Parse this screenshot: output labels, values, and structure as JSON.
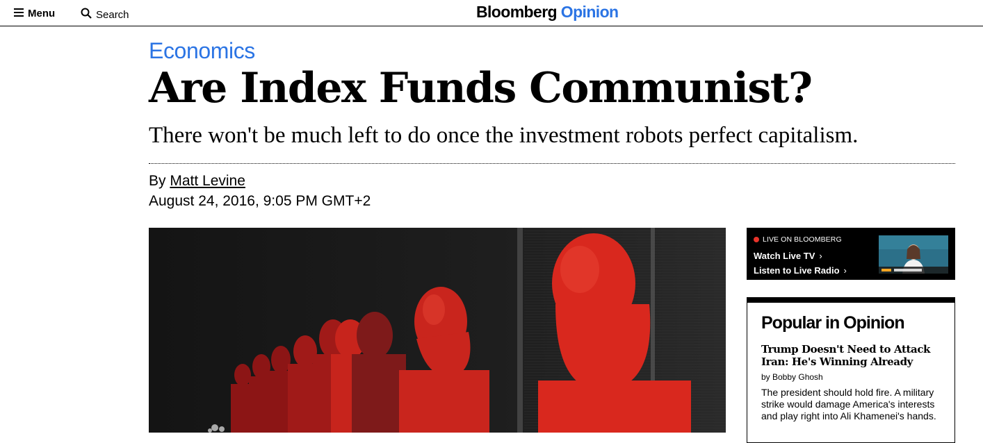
{
  "header": {
    "menu_label": "Menu",
    "search_label": "Search",
    "logo_main": "Bloomberg",
    "logo_accent": "Opinion"
  },
  "article": {
    "category": "Economics",
    "headline": "Are Index Funds Communist?",
    "dek": "There won't be much left to do once the investment robots perfect capitalism.",
    "byline_prefix": "By",
    "author": "Matt Levine",
    "date": "August 24, 2016, 9:05 PM GMT+2"
  },
  "live": {
    "tag": "LIVE ON BLOOMBERG",
    "watch_label": "Watch Live TV",
    "listen_label": "Listen to Live Radio",
    "chevron": "›"
  },
  "popular": {
    "title": "Popular in Opinion",
    "items": [
      {
        "headline": "Trump Doesn't Need to Attack Iran: He's Winning Already",
        "byline": "by Bobby Ghosh",
        "summary": "The president should hold fire. A military strike would damage America's interests and play right into Ali Khamenei's hands."
      }
    ]
  },
  "colors": {
    "accent": "#2b74e4",
    "live_dot": "#e8332a",
    "statue_red": "#d9281e"
  },
  "icons": {
    "menu": "hamburger-menu-icon",
    "search": "search-icon",
    "live": "live-dot-icon",
    "chevron": "chevron-right-icon"
  }
}
